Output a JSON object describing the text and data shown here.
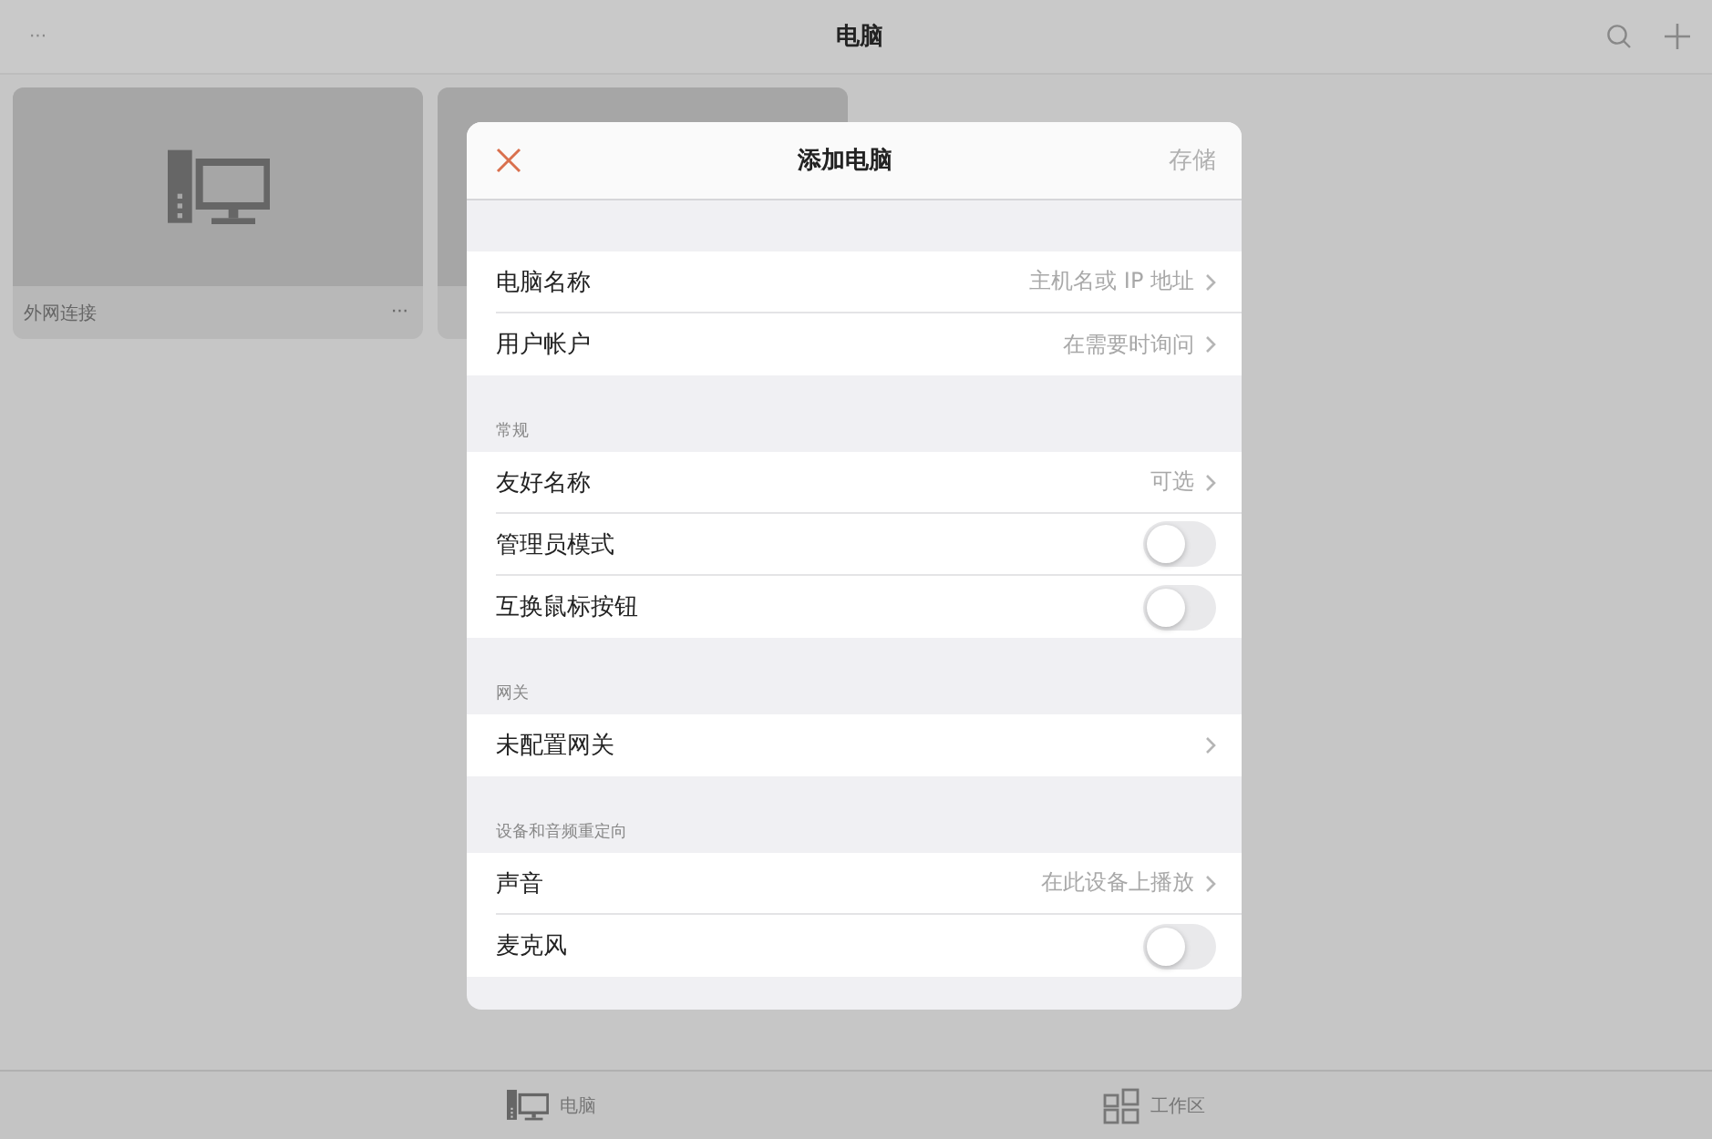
{
  "topbar": {
    "menu": "···",
    "title": "电脑"
  },
  "cards": [
    {
      "kind": "computer",
      "label": "外网连接",
      "more": "···"
    },
    {
      "kind": "covered"
    }
  ],
  "dialog": {
    "title": "添加电脑",
    "save": "存储",
    "sections": [
      {
        "rows": [
          {
            "kind": "link",
            "label": "电脑名称",
            "value": "主机名或 IP 地址"
          },
          {
            "kind": "link",
            "label": "用户帐户",
            "value": "在需要时询问"
          }
        ]
      },
      {
        "header": "常规",
        "rows": [
          {
            "kind": "link",
            "label": "友好名称",
            "value": "可选"
          },
          {
            "kind": "toggle",
            "label": "管理员模式",
            "on": false
          },
          {
            "kind": "toggle",
            "label": "互换鼠标按钮",
            "on": false
          }
        ]
      },
      {
        "header": "网关",
        "rows": [
          {
            "kind": "link",
            "label": "未配置网关"
          }
        ]
      },
      {
        "header": "设备和音频重定向",
        "rows": [
          {
            "kind": "link",
            "label": "声音",
            "value": "在此设备上播放"
          },
          {
            "kind": "toggle",
            "label": "麦克风",
            "on": false
          }
        ]
      }
    ]
  },
  "tabbar": [
    {
      "kind": "computer",
      "label": "电脑"
    },
    {
      "kind": "workspace",
      "label": "工作区"
    }
  ]
}
